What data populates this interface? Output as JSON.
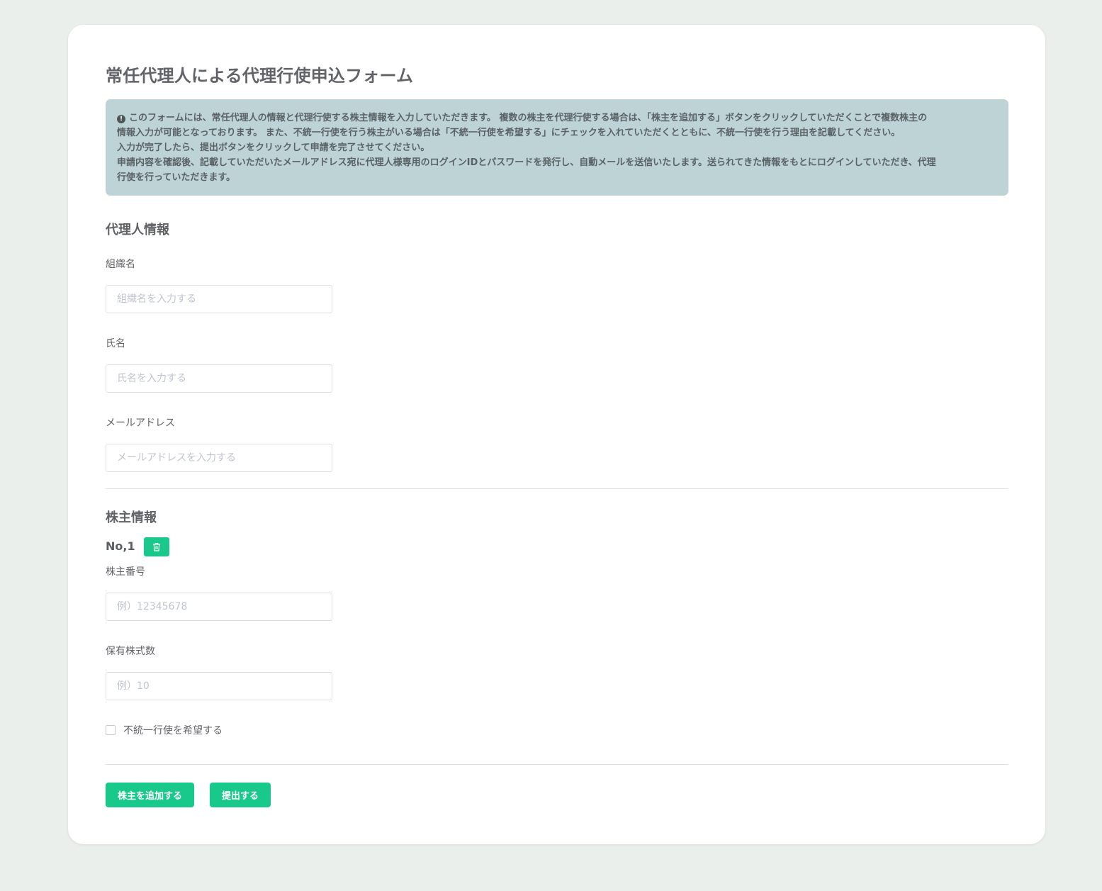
{
  "page": {
    "title": "常任代理人による代理行使申込フォーム"
  },
  "notice": {
    "icon": "exclamation-circle-icon",
    "lines": [
      "このフォームには、常任代理人の情報と代理行使する株主情報を入力していただきます。 複数の株主を代理行使する場合は、「株主を追加する」ボタンをクリックしていただくことで複数株主の",
      "情報入力が可能となっております。 また、不統一行使を行う株主がいる場合は「不統一行使を希望する」にチェックを入れていただくとともに、不統一行使を行う理由を記載してください。",
      "入力が完了したら、提出ボタンをクリックして申請を完了させてください。",
      "申請内容を確認後、記載していただいたメールアドレス宛に代理人様専用のログインIDとパスワードを発行し、自動メールを送信いたします。送られてきた情報をもとにログインしていただき、代理",
      "行使を行っていただきます。"
    ]
  },
  "agent": {
    "section_title": "代理人情報",
    "org_label": "組織名",
    "org_placeholder": "組織名を入力する",
    "org_value": "",
    "name_label": "氏名",
    "name_placeholder": "氏名を入力する",
    "name_value": "",
    "email_label": "メールアドレス",
    "email_placeholder": "メールアドレスを入力する",
    "email_value": ""
  },
  "shareholder": {
    "section_title": "株主情報",
    "entries": [
      {
        "no_label": "No,1",
        "delete_icon": "trash-icon",
        "number_label": "株主番号",
        "number_placeholder": "例）12345678",
        "number_value": "",
        "shares_label": "保有株式数",
        "shares_placeholder": "例）10",
        "shares_value": "",
        "nonuniform_label": "不統一行使を希望する",
        "nonuniform_checked": false
      }
    ]
  },
  "actions": {
    "add_label": "株主を追加する",
    "submit_label": "提出する"
  },
  "colors": {
    "background": "#eaefec",
    "accent": "#19c98c",
    "notice_bg": "#bdd3d6"
  }
}
